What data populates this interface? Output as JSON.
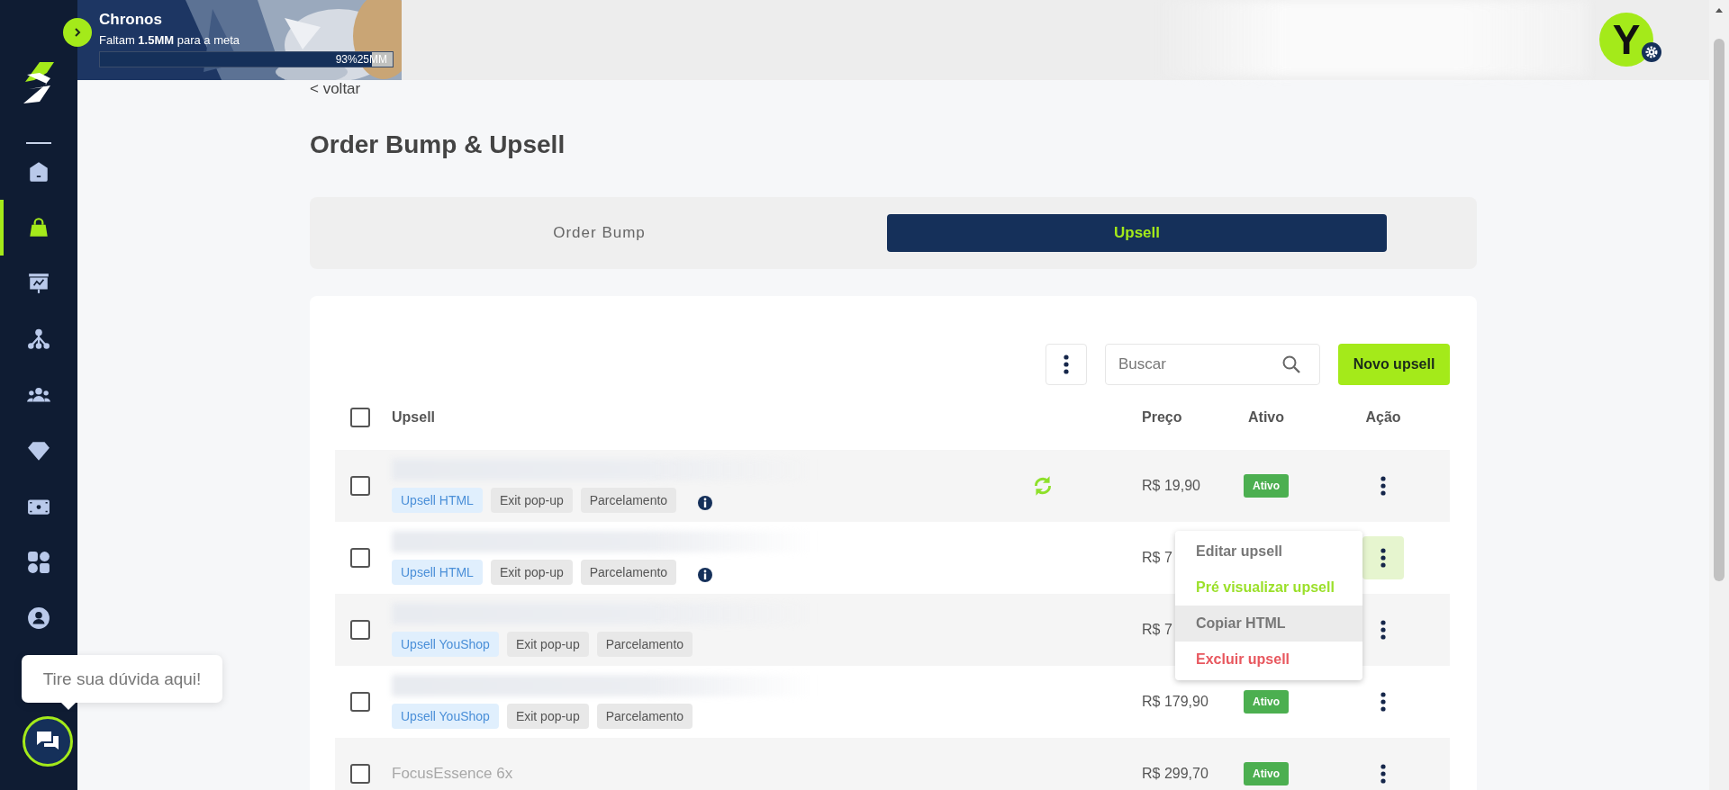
{
  "sidebar": {
    "items": [
      {
        "kind": "home",
        "selected": false
      },
      {
        "kind": "bag",
        "selected": true
      },
      {
        "kind": "presentation",
        "selected": false
      },
      {
        "kind": "network",
        "selected": false
      },
      {
        "kind": "people",
        "selected": false
      },
      {
        "kind": "diamond",
        "selected": false
      },
      {
        "kind": "money",
        "selected": false
      },
      {
        "kind": "apps",
        "selected": false
      },
      {
        "kind": "user",
        "selected": false
      }
    ]
  },
  "banner": {
    "title": "Chronos",
    "subtitle": "Faltam **1.5MM** para a meta",
    "progress": {
      "level": 0.93,
      "label": "93%25MM"
    }
  },
  "user": {
    "avatar_letter": "Y"
  },
  "back_link": "< voltar",
  "page_title": "Order Bump & Upsell",
  "tabs": [
    {
      "label": "Order Bump",
      "selected": false
    },
    {
      "label": "Upsell",
      "selected": true
    }
  ],
  "toolbar": {
    "search": {
      "placeholder": "Buscar"
    },
    "new_button": "Novo upsell"
  },
  "table": {
    "header_checked": false,
    "columns": [
      "Upsell",
      "Preço",
      "Ativo",
      "Ação"
    ],
    "rows": [
      {
        "checked": false,
        "tags": [
          {
            "label": "Upsell HTML",
            "kind": "type"
          },
          {
            "label": "Exit pop-up",
            "kind": "plain"
          },
          {
            "label": "Parcelamento",
            "kind": "plain"
          }
        ],
        "info": true,
        "sync": true,
        "price": "R$ 19,90",
        "status": "Ativo",
        "action_selected": false
      },
      {
        "checked": false,
        "tags": [
          {
            "label": "Upsell HTML",
            "kind": "type"
          },
          {
            "label": "Exit pop-up",
            "kind": "plain"
          },
          {
            "label": "Parcelamento",
            "kind": "plain"
          }
        ],
        "info": true,
        "sync": false,
        "price": "R$ 7",
        "action_selected": true
      },
      {
        "checked": false,
        "tags": [
          {
            "label": "Upsell YouShop",
            "kind": "type"
          },
          {
            "label": "Exit pop-up",
            "kind": "plain"
          },
          {
            "label": "Parcelamento",
            "kind": "plain"
          }
        ],
        "info": false,
        "sync": false,
        "price": "R$ 7",
        "action_selected": false
      },
      {
        "checked": false,
        "tags": [
          {
            "label": "Upsell YouShop",
            "kind": "type"
          },
          {
            "label": "Exit pop-up",
            "kind": "plain"
          },
          {
            "label": "Parcelamento",
            "kind": "plain"
          }
        ],
        "info": false,
        "sync": false,
        "price": "R$ 179,90",
        "status": "Ativo",
        "action_selected": false
      },
      {
        "checked": false,
        "name": "FocusEssence 6x",
        "info": false,
        "sync": false,
        "price": "R$ 299,70",
        "status": "Ativo",
        "action_selected": false
      }
    ]
  },
  "action_menu": {
    "items": [
      {
        "label": "Editar upsell",
        "kind": "default",
        "hovered": false
      },
      {
        "label": "Pré visualizar upsell",
        "kind": "accent",
        "hovered": false
      },
      {
        "label": "Copiar HTML",
        "kind": "default",
        "hovered": true
      },
      {
        "label": "Excluir upsell",
        "kind": "danger",
        "hovered": false
      }
    ]
  },
  "chat": {
    "tooltip": "Tire sua dúvida aqui!"
  }
}
